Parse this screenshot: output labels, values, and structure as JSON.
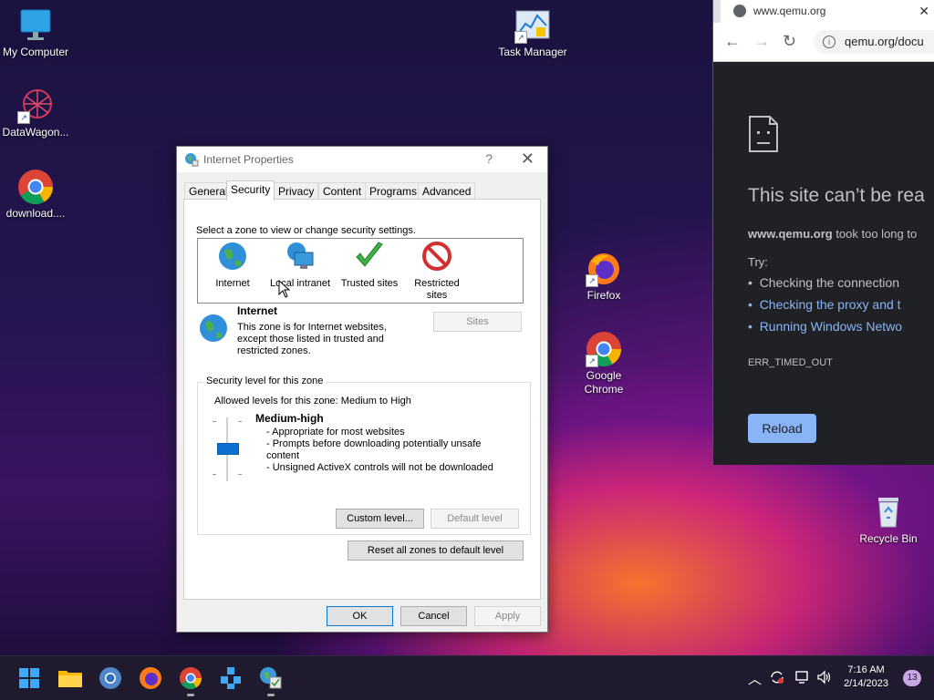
{
  "desktop": {
    "icons": [
      {
        "label": "My Computer"
      },
      {
        "label": "DataWagon..."
      },
      {
        "label": "download...."
      },
      {
        "label": "Task Manager"
      },
      {
        "label": "Firefox"
      },
      {
        "label": "Google Chrome"
      },
      {
        "label": "Recycle Bin"
      }
    ]
  },
  "dialog": {
    "title": "Internet Properties",
    "help": "?",
    "close": "✕",
    "tabs": [
      "General",
      "Security",
      "Privacy",
      "Content",
      "Programs",
      "Advanced"
    ],
    "active_tab": "Security",
    "zone_prompt": "Select a zone to view or change security settings.",
    "zones": [
      {
        "label": "Internet"
      },
      {
        "label": "Local intranet"
      },
      {
        "label": "Trusted sites"
      },
      {
        "label": "Restricted sites"
      }
    ],
    "selected_zone": {
      "name": "Internet",
      "description": "This zone is for Internet websites, except those listed in trusted and restricted zones.",
      "sites_button": "Sites"
    },
    "security_group": {
      "title": "Security level for this zone",
      "allowed": "Allowed levels for this zone: Medium to High",
      "level_name": "Medium-high",
      "level_desc": [
        "- Appropriate for most websites",
        "- Prompts before downloading potentially unsafe content",
        "- Unsigned ActiveX controls will not be downloaded"
      ],
      "custom_button": "Custom level...",
      "default_button": "Default level"
    },
    "reset_button": "Reset all zones to default level",
    "ok_button": "OK",
    "cancel_button": "Cancel",
    "apply_button": "Apply"
  },
  "browser": {
    "tab_title": "www.qemu.org",
    "tab_close": "✕",
    "url": "qemu.org/docu",
    "error_title": "This site can’t be rea",
    "error_host": "www.qemu.org",
    "error_host_rest": " took too long to",
    "try_label": "Try:",
    "suggestions": [
      "Checking the connection",
      "Checking the proxy and t",
      "Running Windows Netwo"
    ],
    "error_code": "ERR_TIMED_OUT",
    "reload_button": "Reload"
  },
  "taskbar": {
    "time": "7:16 AM",
    "date": "2/14/2023",
    "notification_count": "13"
  },
  "colors": {
    "accent": "#0a6fd0",
    "chrome_link": "#8ab4f8",
    "chrome_bg": "#202124"
  }
}
